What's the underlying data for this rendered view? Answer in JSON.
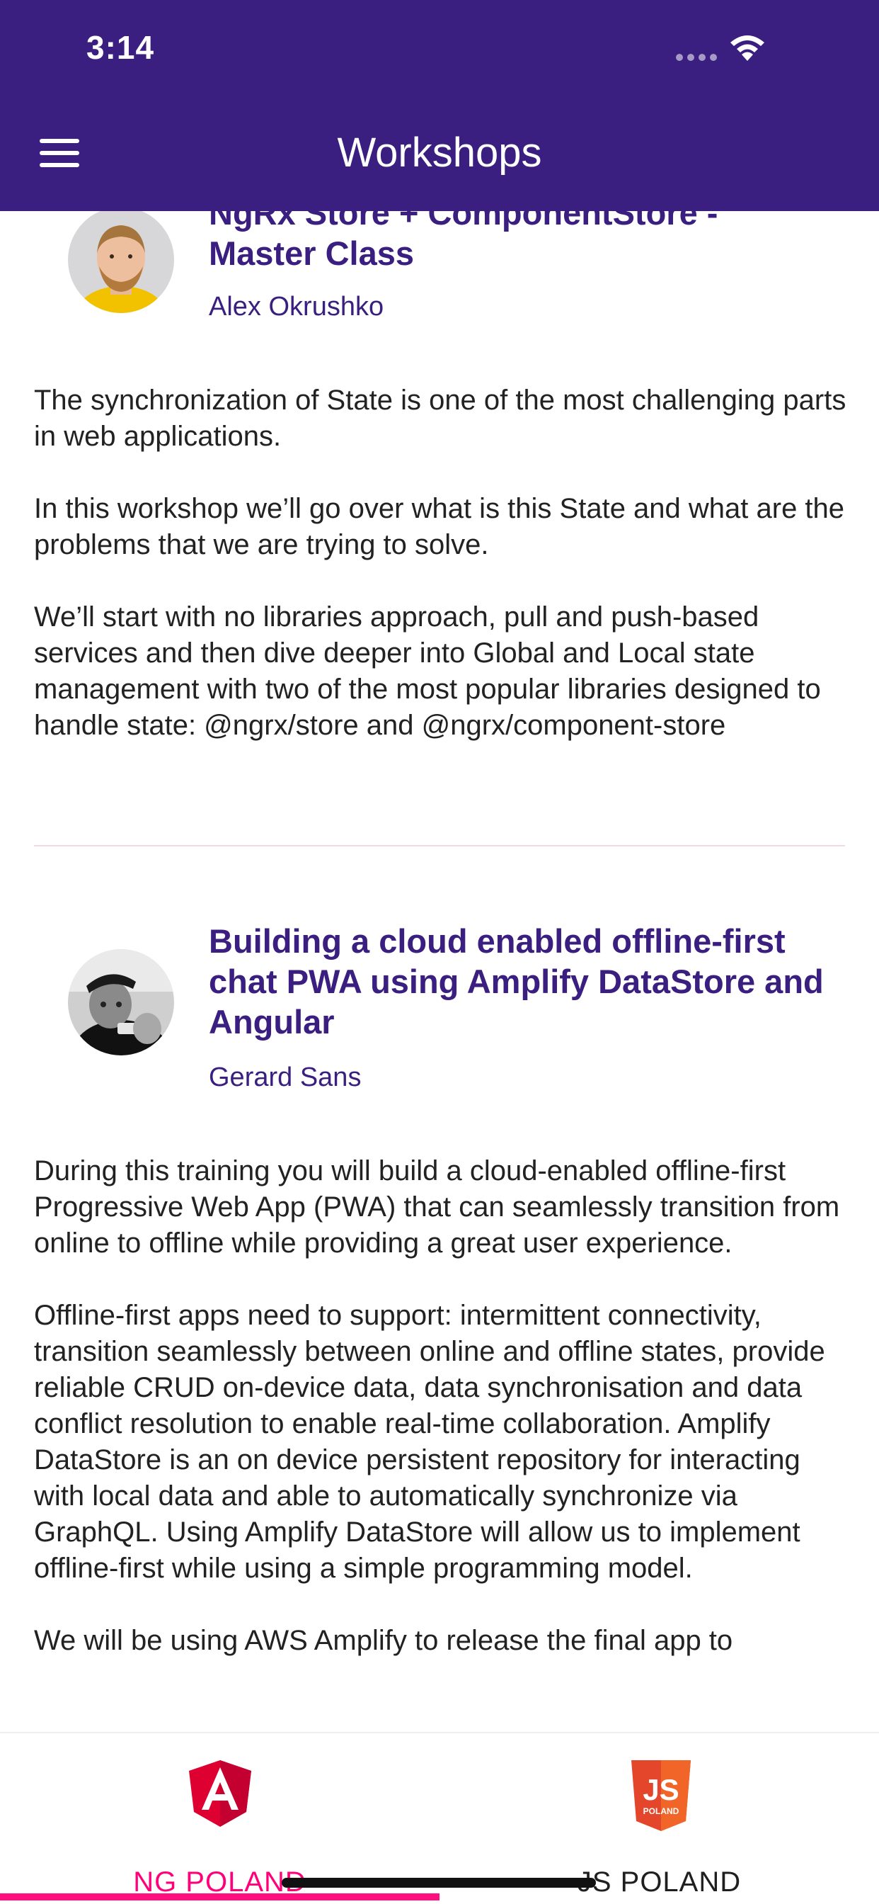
{
  "status_bar": {
    "time": "3:14"
  },
  "header": {
    "title": "Workshops"
  },
  "workshops": [
    {
      "title": "NgRx Store + ComponentStore - Master Class",
      "author": "Alex Okrushko",
      "description": [
        "The synchronization of State is one of the most challenging parts in web applications.",
        "In this workshop we’ll go over what is this State and what are the problems that we are trying to solve.",
        "We’ll start with no libraries approach, pull and push-based services and then dive deeper into Global and Local state management with two of the most popular libraries designed to handle state: @ngrx/store and @ngrx/component-store"
      ]
    },
    {
      "title": "Building a cloud enabled offline-first chat PWA using Amplify DataStore and Angular",
      "author": "Gerard Sans",
      "description": [
        "During this training you will build a cloud-enabled offline-first Progressive Web App (PWA) that can seamlessly transition from online to offline while providing a great user experience.",
        "Offline-first apps need to support: intermittent connectivity, transition seamlessly between online and offline states, provide reliable CRUD on-device data, data synchronisation and data conflict resolution to enable real-time collaboration. Amplify DataStore is an on device persistent repository for interacting with local data and able to automatically synchronize via GraphQL. Using Amplify DataStore will allow us to implement offline-first while using a simple programming model.",
        "We will be using AWS Amplify to release the final app to"
      ]
    }
  ],
  "bottom_nav": {
    "tabs": [
      {
        "label": "NG POLAND",
        "icon": "angular-logo-icon",
        "badge_letter": "A",
        "selected": true
      },
      {
        "label": "JS POLAND",
        "icon": "js-poland-logo-icon",
        "badge_letters": "JS",
        "badge_sub": "POLAND",
        "selected": false
      }
    ]
  },
  "colors": {
    "primary": "#3a1f80",
    "accent": "#ff007a",
    "angular_red": "#dd0031",
    "js_orange": "#e4462b"
  }
}
